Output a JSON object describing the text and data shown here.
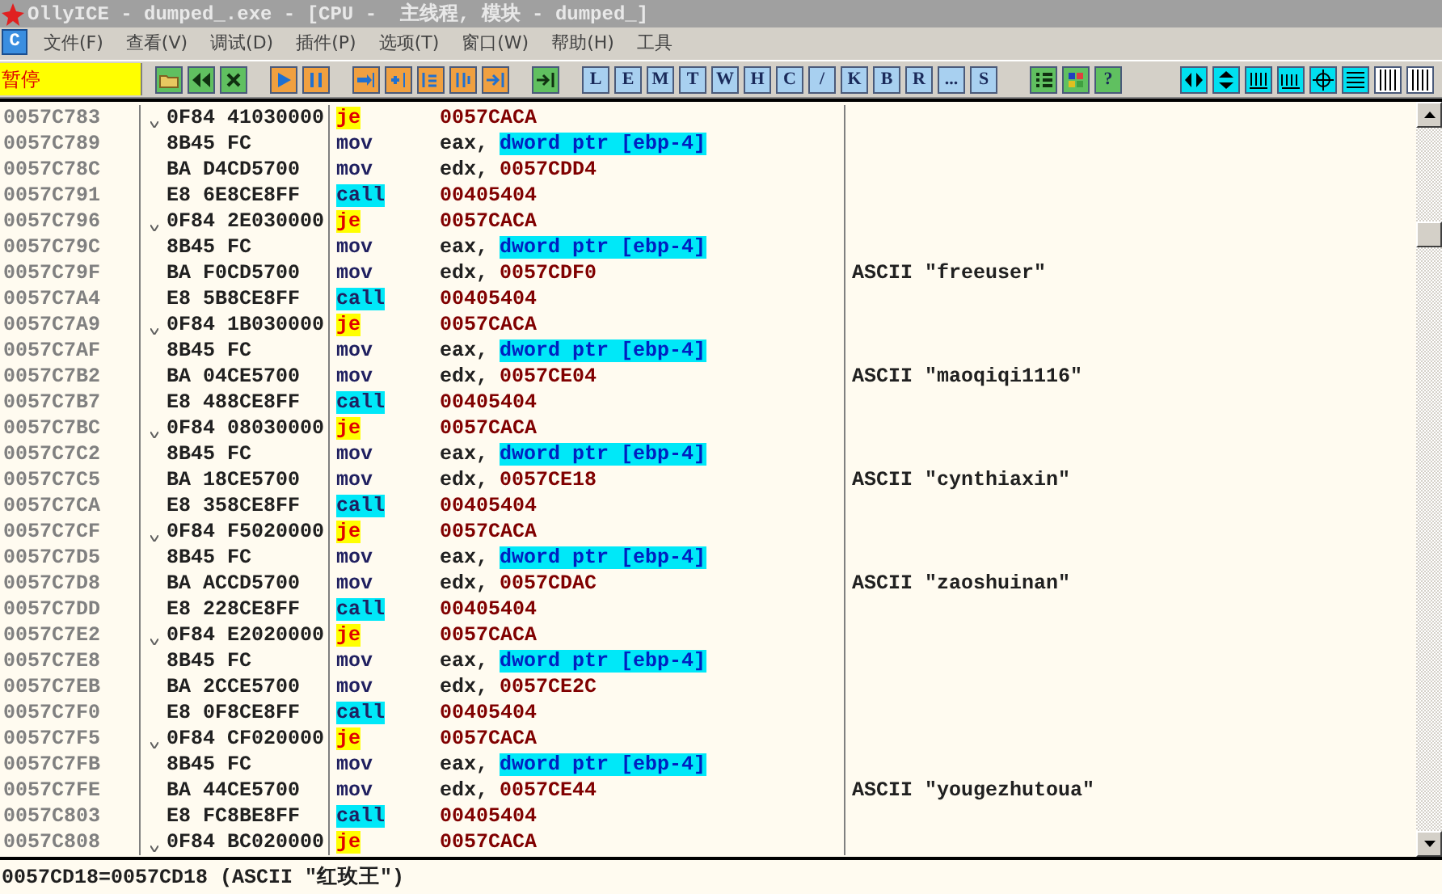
{
  "window": {
    "title": "OllyICE - dumped_.exe - [CPU -  主线程, 模块 - dumped_]"
  },
  "menu": {
    "icon_label": "C",
    "items": [
      "文件(F)",
      "查看(V)",
      "调试(D)",
      "插件(P)",
      "选项(T)",
      "窗口(W)",
      "帮助(H)",
      "工具"
    ]
  },
  "toolbar": {
    "status": "暂停",
    "letter_buttons": [
      "L",
      "E",
      "M",
      "T",
      "W",
      "H",
      "C",
      "/",
      "K",
      "B",
      "R",
      "...",
      "S"
    ],
    "help_label": "?"
  },
  "disassembly": {
    "rows": [
      {
        "address": "0057C783",
        "jump_source": true,
        "hex": "0F84 41030000",
        "mnemonic": "je",
        "kind": "jump",
        "operands": [
          {
            "text": "0057CACA",
            "kind": "value"
          }
        ]
      },
      {
        "address": "0057C789",
        "jump_source": false,
        "hex": "8B45 FC",
        "mnemonic": "mov",
        "kind": "plain",
        "operands": [
          {
            "text": "eax,",
            "kind": "register"
          },
          {
            "text": "dword ptr [ebp-4]",
            "kind": "memory"
          }
        ]
      },
      {
        "address": "0057C78C",
        "jump_source": false,
        "hex": "BA D4CD5700",
        "mnemonic": "mov",
        "kind": "plain",
        "operands": [
          {
            "text": "edx,",
            "kind": "register"
          },
          {
            "text": "0057CDD4",
            "kind": "value"
          }
        ]
      },
      {
        "address": "0057C791",
        "jump_source": false,
        "hex": "E8 6E8CE8FF",
        "mnemonic": "call",
        "kind": "call",
        "operands": [
          {
            "text": "00405404",
            "kind": "value"
          }
        ]
      },
      {
        "address": "0057C796",
        "jump_source": true,
        "hex": "0F84 2E030000",
        "mnemonic": "je",
        "kind": "jump",
        "operands": [
          {
            "text": "0057CACA",
            "kind": "value"
          }
        ]
      },
      {
        "address": "0057C79C",
        "jump_source": false,
        "hex": "8B45 FC",
        "mnemonic": "mov",
        "kind": "plain",
        "operands": [
          {
            "text": "eax,",
            "kind": "register"
          },
          {
            "text": "dword ptr [ebp-4]",
            "kind": "memory"
          }
        ]
      },
      {
        "address": "0057C79F",
        "jump_source": false,
        "hex": "BA F0CD5700",
        "mnemonic": "mov",
        "kind": "plain",
        "operands": [
          {
            "text": "edx,",
            "kind": "register"
          },
          {
            "text": "0057CDF0",
            "kind": "value"
          }
        ],
        "comment": "ASCII \"freeuser\""
      },
      {
        "address": "0057C7A4",
        "jump_source": false,
        "hex": "E8 5B8CE8FF",
        "mnemonic": "call",
        "kind": "call",
        "operands": [
          {
            "text": "00405404",
            "kind": "value"
          }
        ]
      },
      {
        "address": "0057C7A9",
        "jump_source": true,
        "hex": "0F84 1B030000",
        "mnemonic": "je",
        "kind": "jump",
        "operands": [
          {
            "text": "0057CACA",
            "kind": "value"
          }
        ]
      },
      {
        "address": "0057C7AF",
        "jump_source": false,
        "hex": "8B45 FC",
        "mnemonic": "mov",
        "kind": "plain",
        "operands": [
          {
            "text": "eax,",
            "kind": "register"
          },
          {
            "text": "dword ptr [ebp-4]",
            "kind": "memory"
          }
        ]
      },
      {
        "address": "0057C7B2",
        "jump_source": false,
        "hex": "BA 04CE5700",
        "mnemonic": "mov",
        "kind": "plain",
        "operands": [
          {
            "text": "edx,",
            "kind": "register"
          },
          {
            "text": "0057CE04",
            "kind": "value"
          }
        ],
        "comment": "ASCII \"maoqiqi1116\""
      },
      {
        "address": "0057C7B7",
        "jump_source": false,
        "hex": "E8 488CE8FF",
        "mnemonic": "call",
        "kind": "call",
        "operands": [
          {
            "text": "00405404",
            "kind": "value"
          }
        ]
      },
      {
        "address": "0057C7BC",
        "jump_source": true,
        "hex": "0F84 08030000",
        "mnemonic": "je",
        "kind": "jump",
        "operands": [
          {
            "text": "0057CACA",
            "kind": "value"
          }
        ]
      },
      {
        "address": "0057C7C2",
        "jump_source": false,
        "hex": "8B45 FC",
        "mnemonic": "mov",
        "kind": "plain",
        "operands": [
          {
            "text": "eax,",
            "kind": "register"
          },
          {
            "text": "dword ptr [ebp-4]",
            "kind": "memory"
          }
        ]
      },
      {
        "address": "0057C7C5",
        "jump_source": false,
        "hex": "BA 18CE5700",
        "mnemonic": "mov",
        "kind": "plain",
        "operands": [
          {
            "text": "edx,",
            "kind": "register"
          },
          {
            "text": "0057CE18",
            "kind": "value"
          }
        ],
        "comment": "ASCII \"cynthiaxin\""
      },
      {
        "address": "0057C7CA",
        "jump_source": false,
        "hex": "E8 358CE8FF",
        "mnemonic": "call",
        "kind": "call",
        "operands": [
          {
            "text": "00405404",
            "kind": "value"
          }
        ]
      },
      {
        "address": "0057C7CF",
        "jump_source": true,
        "hex": "0F84 F5020000",
        "mnemonic": "je",
        "kind": "jump",
        "operands": [
          {
            "text": "0057CACA",
            "kind": "value"
          }
        ]
      },
      {
        "address": "0057C7D5",
        "jump_source": false,
        "hex": "8B45 FC",
        "mnemonic": "mov",
        "kind": "plain",
        "operands": [
          {
            "text": "eax,",
            "kind": "register"
          },
          {
            "text": "dword ptr [ebp-4]",
            "kind": "memory"
          }
        ]
      },
      {
        "address": "0057C7D8",
        "jump_source": false,
        "hex": "BA ACCD5700",
        "mnemonic": "mov",
        "kind": "plain",
        "operands": [
          {
            "text": "edx,",
            "kind": "register"
          },
          {
            "text": "0057CDAC",
            "kind": "value"
          }
        ],
        "comment": "ASCII \"zaoshuinan\""
      },
      {
        "address": "0057C7DD",
        "jump_source": false,
        "hex": "E8 228CE8FF",
        "mnemonic": "call",
        "kind": "call",
        "operands": [
          {
            "text": "00405404",
            "kind": "value"
          }
        ]
      },
      {
        "address": "0057C7E2",
        "jump_source": true,
        "hex": "0F84 E2020000",
        "mnemonic": "je",
        "kind": "jump",
        "operands": [
          {
            "text": "0057CACA",
            "kind": "value"
          }
        ]
      },
      {
        "address": "0057C7E8",
        "jump_source": false,
        "hex": "8B45 FC",
        "mnemonic": "mov",
        "kind": "plain",
        "operands": [
          {
            "text": "eax,",
            "kind": "register"
          },
          {
            "text": "dword ptr [ebp-4]",
            "kind": "memory"
          }
        ]
      },
      {
        "address": "0057C7EB",
        "jump_source": false,
        "hex": "BA 2CCE5700",
        "mnemonic": "mov",
        "kind": "plain",
        "operands": [
          {
            "text": "edx,",
            "kind": "register"
          },
          {
            "text": "0057CE2C",
            "kind": "value"
          }
        ]
      },
      {
        "address": "0057C7F0",
        "jump_source": false,
        "hex": "E8 0F8CE8FF",
        "mnemonic": "call",
        "kind": "call",
        "operands": [
          {
            "text": "00405404",
            "kind": "value"
          }
        ]
      },
      {
        "address": "0057C7F5",
        "jump_source": true,
        "hex": "0F84 CF020000",
        "mnemonic": "je",
        "kind": "jump",
        "operands": [
          {
            "text": "0057CACA",
            "kind": "value"
          }
        ]
      },
      {
        "address": "0057C7FB",
        "jump_source": false,
        "hex": "8B45 FC",
        "mnemonic": "mov",
        "kind": "plain",
        "operands": [
          {
            "text": "eax,",
            "kind": "register"
          },
          {
            "text": "dword ptr [ebp-4]",
            "kind": "memory"
          }
        ]
      },
      {
        "address": "0057C7FE",
        "jump_source": false,
        "hex": "BA 44CE5700",
        "mnemonic": "mov",
        "kind": "plain",
        "operands": [
          {
            "text": "edx,",
            "kind": "register"
          },
          {
            "text": "0057CE44",
            "kind": "value"
          }
        ],
        "comment": "ASCII \"yougezhutoua\""
      },
      {
        "address": "0057C803",
        "jump_source": false,
        "hex": "E8 FC8BE8FF",
        "mnemonic": "call",
        "kind": "call",
        "operands": [
          {
            "text": "00405404",
            "kind": "value"
          }
        ]
      },
      {
        "address": "0057C808",
        "jump_source": true,
        "hex": "0F84 BC020000",
        "mnemonic": "je",
        "kind": "jump",
        "operands": [
          {
            "text": "0057CACA",
            "kind": "value"
          }
        ]
      }
    ]
  },
  "status_bar": {
    "text": "0057CD18=0057CD18 (ASCII \"红玫王\")"
  }
}
